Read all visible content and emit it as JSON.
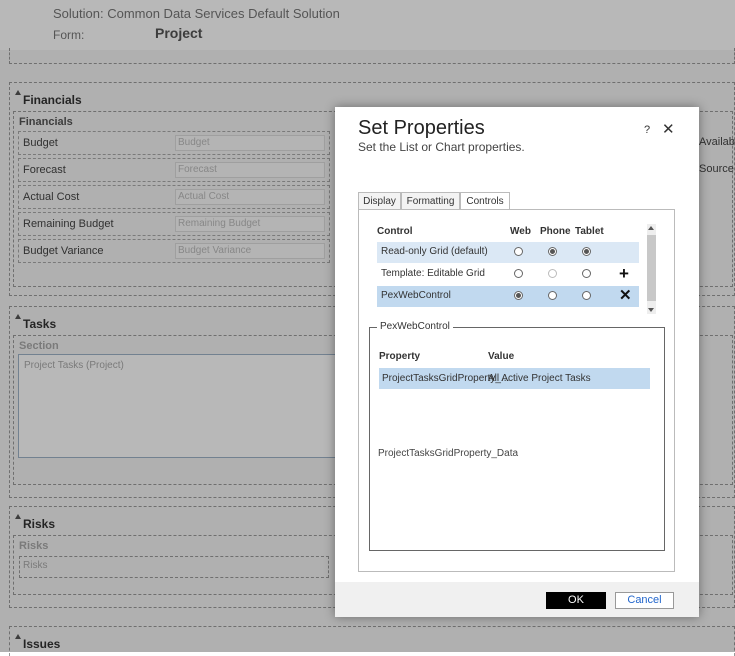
{
  "header": {
    "solution": "Solution: Common Data Services Default Solution",
    "form_label": "Form:",
    "form_name": "Project"
  },
  "form": {
    "financials": {
      "title": "Financials",
      "subtitle": "Financials",
      "fields": [
        {
          "label": "Budget",
          "placeholder": "Budget"
        },
        {
          "label": "Forecast",
          "placeholder": "Forecast"
        },
        {
          "label": "Actual Cost",
          "placeholder": "Actual Cost"
        },
        {
          "label": "Remaining Budget",
          "placeholder": "Remaining Budget"
        },
        {
          "label": "Budget Variance",
          "placeholder": "Budget Variance"
        }
      ],
      "right_labels": [
        "Available",
        "Source"
      ]
    },
    "tasks": {
      "title": "Tasks",
      "subtitle": "Section",
      "grid": "Project Tasks (Project)"
    },
    "risks": {
      "title": "Risks",
      "subtitle": "Risks",
      "grid": "Risks"
    },
    "issues": {
      "title": "Issues"
    }
  },
  "dialog": {
    "title": "Set Properties",
    "subtitle": "Set the List or Chart properties.",
    "help": "?",
    "close": "✕",
    "tabs": [
      "Display",
      "Formatting",
      "Controls"
    ],
    "active_tab": "Controls",
    "controls_table": {
      "headers": [
        "Control",
        "Web",
        "Phone",
        "Tablet"
      ],
      "rows": [
        {
          "name": "Read-only Grid (default)",
          "web": false,
          "phone": true,
          "tablet": true,
          "action": ""
        },
        {
          "name": "Template: Editable Grid",
          "web": false,
          "phone": false,
          "tablet": false,
          "action": "+"
        },
        {
          "name": "PexWebControl",
          "web": true,
          "phone": false,
          "tablet": false,
          "action": "✕"
        }
      ]
    },
    "property_group": {
      "legend": "PexWebControl",
      "headers": [
        "Property",
        "Value"
      ],
      "row": {
        "property": "ProjectTasksGridProperty_...",
        "value": "All Active Project Tasks"
      },
      "description": "ProjectTasksGridProperty_Data"
    },
    "ok_label": "OK",
    "cancel_label": "Cancel"
  }
}
